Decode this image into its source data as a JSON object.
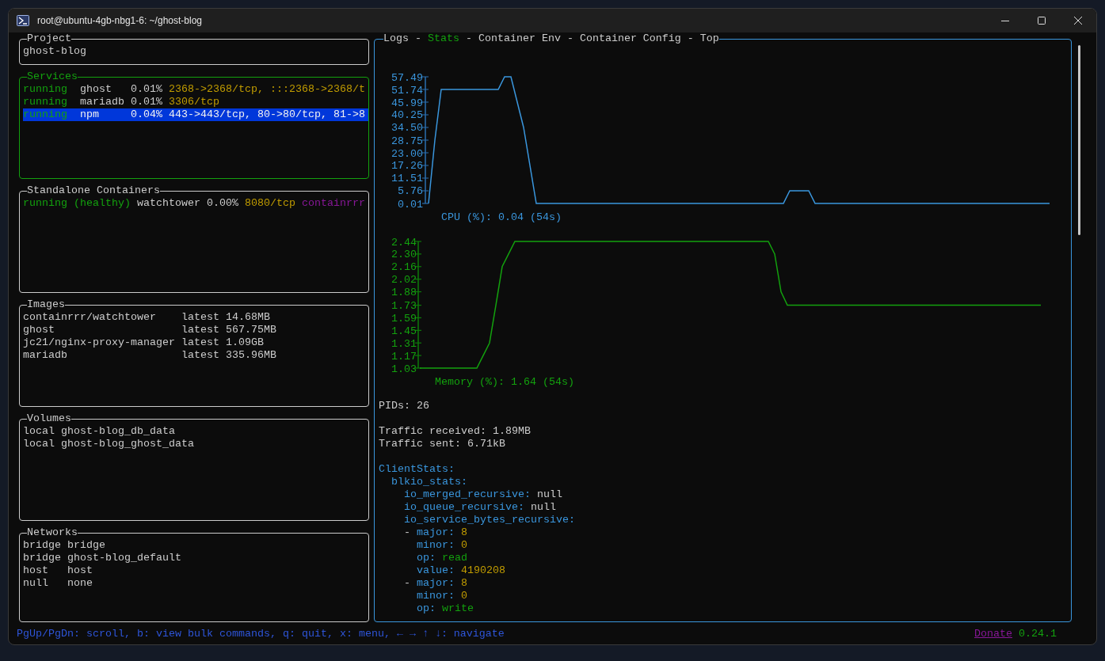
{
  "window": {
    "title": "root@ubuntu-4gb-nbg1-6: ~/ghost-blog"
  },
  "project": {
    "title": "Project",
    "name": "ghost-blog"
  },
  "services": {
    "title": "Services",
    "rows": [
      {
        "status": "running",
        "name": "ghost",
        "cpu": "0.01%",
        "ports": "2368->2368/tcp, :::2368->2368/t",
        "selected": false
      },
      {
        "status": "running",
        "name": "mariadb",
        "cpu": "0.01%",
        "ports": "3306/tcp",
        "selected": false
      },
      {
        "status": "running",
        "name": "npm",
        "cpu": "0.04%",
        "ports": "443->443/tcp, 80->80/tcp, 81->8",
        "selected": true
      }
    ]
  },
  "standalone_containers": {
    "title": "Standalone Containers",
    "rows": [
      {
        "status": "running (healthy)",
        "name": "watchtower",
        "cpu": "0.00%",
        "ports": "8080/tcp",
        "image": "containrrr"
      }
    ]
  },
  "images": {
    "title": "Images",
    "rows": [
      {
        "name": "containrrr/watchtower",
        "tag": "latest",
        "size": "14.68MB"
      },
      {
        "name": "ghost",
        "tag": "latest",
        "size": "567.75MB"
      },
      {
        "name": "jc21/nginx-proxy-manager",
        "tag": "latest",
        "size": "1.09GB"
      },
      {
        "name": "mariadb",
        "tag": "latest",
        "size": "335.96MB"
      }
    ]
  },
  "volumes": {
    "title": "Volumes",
    "rows": [
      {
        "driver": "local",
        "name": "ghost-blog_db_data"
      },
      {
        "driver": "local",
        "name": "ghost-blog_ghost_data"
      }
    ]
  },
  "networks": {
    "title": "Networks",
    "rows": [
      {
        "driver": "bridge",
        "name": "bridge"
      },
      {
        "driver": "bridge",
        "name": "ghost-blog_default"
      },
      {
        "driver": "host",
        "name": "host"
      },
      {
        "driver": "null",
        "name": "none"
      }
    ]
  },
  "detail_panel": {
    "tabs": [
      {
        "label": "Logs",
        "selected": false
      },
      {
        "label": "Stats",
        "selected": true
      },
      {
        "label": "Container Env",
        "selected": false
      },
      {
        "label": "Container Config",
        "selected": false
      },
      {
        "label": "Top",
        "selected": false
      }
    ],
    "tab_separators": [
      "-",
      "-",
      "-",
      "-"
    ],
    "cpu_chart": {
      "chart_data": {
        "type": "line",
        "title": "CPU (%): 0.04 (54s)",
        "ylim": [
          0.01,
          57.49
        ],
        "yticks": [
          {
            "value": 57.49,
            "label": "57.49"
          },
          {
            "value": 51.74,
            "label": "51.74"
          },
          {
            "value": 45.99,
            "label": "45.99"
          },
          {
            "value": 40.25,
            "label": "40.25"
          },
          {
            "value": 34.5,
            "label": "34.50"
          },
          {
            "value": 28.75,
            "label": "28.75"
          },
          {
            "value": 23,
            "label": "23.00"
          },
          {
            "value": 17.26,
            "label": "17.26"
          },
          {
            "value": 11.51,
            "label": "11.51"
          },
          {
            "value": 5.76,
            "label": "5.76"
          },
          {
            "value": 0.01,
            "label": "0.01"
          }
        ],
        "series": [
          {
            "color": "#3a96dd",
            "values": [
              0.01,
              28.75,
              51.74,
              51.74,
              51.74,
              51.74,
              51.74,
              51.74,
              51.74,
              51.74,
              51.74,
              51.74,
              57.49,
              57.49,
              45.99,
              34.5,
              17.26,
              0.01,
              0.01,
              0.01,
              0.01,
              0.01,
              0.01,
              0.01,
              0.01,
              0.01,
              0.01,
              0.01,
              0.01,
              0.01,
              0.01,
              0.01,
              0.01,
              0.01,
              0.01,
              0.01,
              0.01,
              0.01,
              0.01,
              0.01,
              0.01,
              0.01,
              0.01,
              0.01,
              0.01,
              0.01,
              0.01,
              0.01,
              0.01,
              0.01,
              0.01,
              0.01,
              0.01,
              0.01,
              0.01,
              0.01,
              0.01,
              5.76,
              5.76,
              5.76,
              5.76,
              0.01,
              0.01,
              0.01,
              0.01,
              0.01,
              0.01,
              0.01,
              0.01,
              0.01,
              0.01,
              0.01,
              0.01,
              0.01,
              0.01,
              0.01,
              0.01,
              0.01,
              0.01,
              0.01,
              0.01,
              0.01,
              0.01,
              0.01,
              0.01,
              0.01,
              0.01,
              0.01,
              0.01,
              0.01,
              0.01,
              0.01,
              0.01,
              0.01,
              0.01,
              0.01,
              0.01,
              0.01,
              0.01
            ]
          }
        ]
      }
    },
    "memory_chart": {
      "chart_data": {
        "type": "line",
        "title": "Memory (%): 1.64 (54s)",
        "ylim": [
          1.03,
          2.44
        ],
        "yticks": [
          {
            "value": 2.44,
            "label": "2.44"
          },
          {
            "value": 2.3,
            "label": "2.30"
          },
          {
            "value": 2.16,
            "label": "2.16"
          },
          {
            "value": 2.02,
            "label": "2.02"
          },
          {
            "value": 1.88,
            "label": "1.88"
          },
          {
            "value": 1.73,
            "label": "1.73"
          },
          {
            "value": 1.59,
            "label": "1.59"
          },
          {
            "value": 1.45,
            "label": "1.45"
          },
          {
            "value": 1.31,
            "label": "1.31"
          },
          {
            "value": 1.17,
            "label": "1.17"
          },
          {
            "value": 1.03,
            "label": "1.03"
          }
        ],
        "series": [
          {
            "color": "#13a10e",
            "values": [
              1.03,
              1.03,
              1.03,
              1.03,
              1.03,
              1.03,
              1.03,
              1.03,
              1.03,
              1.03,
              1.17,
              1.31,
              1.73,
              2.16,
              2.3,
              2.44,
              2.44,
              2.44,
              2.44,
              2.44,
              2.44,
              2.44,
              2.44,
              2.44,
              2.44,
              2.44,
              2.44,
              2.44,
              2.44,
              2.44,
              2.44,
              2.44,
              2.44,
              2.44,
              2.44,
              2.44,
              2.44,
              2.44,
              2.44,
              2.44,
              2.44,
              2.44,
              2.44,
              2.44,
              2.44,
              2.44,
              2.44,
              2.44,
              2.44,
              2.44,
              2.44,
              2.44,
              2.44,
              2.44,
              2.44,
              2.44,
              2.3,
              1.88,
              1.73,
              1.73,
              1.73,
              1.73,
              1.73,
              1.73,
              1.73,
              1.73,
              1.73,
              1.73,
              1.73,
              1.73,
              1.73,
              1.73,
              1.73,
              1.73,
              1.73,
              1.73,
              1.73,
              1.73,
              1.73,
              1.73,
              1.73,
              1.73,
              1.73,
              1.73,
              1.73,
              1.73,
              1.73,
              1.73,
              1.73,
              1.73,
              1.73,
              1.73,
              1.73,
              1.73,
              1.73,
              1.73,
              1.73,
              1.73,
              1.73
            ]
          }
        ]
      }
    },
    "pids": "PIDs: 26",
    "traffic": [
      "Traffic received: 1.89MB",
      "Traffic sent: 6.71kB"
    ],
    "client_stats": [
      {
        "key": "ClientStats:",
        "children": [
          {
            "key": "blkio_stats:",
            "children": [
              {
                "key": "io_merged_recursive:",
                "value": "null",
                "kind": "null"
              },
              {
                "key": "io_queue_recursive:",
                "value": "null",
                "kind": "null"
              },
              {
                "key": "io_service_bytes_recursive:",
                "children": [
                  {
                    "kind": "list_item",
                    "marker": "-",
                    "children": [
                      {
                        "key": "major:",
                        "value": "8",
                        "kind": "number"
                      },
                      {
                        "key": "minor:",
                        "value": "0",
                        "kind": "number"
                      },
                      {
                        "key": "op:",
                        "value": "read",
                        "kind": "string"
                      },
                      {
                        "key": "value:",
                        "value": "4190208",
                        "kind": "number"
                      }
                    ]
                  },
                  {
                    "kind": "list_item",
                    "marker": "-",
                    "children": [
                      {
                        "key": "major:",
                        "value": "8",
                        "kind": "number"
                      },
                      {
                        "key": "minor:",
                        "value": "0",
                        "kind": "number"
                      },
                      {
                        "key": "op:",
                        "value": "write",
                        "kind": "string"
                      }
                    ]
                  }
                ]
              }
            ]
          }
        ]
      }
    ]
  },
  "status_bar": {
    "help": "PgUp/PgDn: scroll, b: view bulk commands, q: quit, x: menu, ← → ↑ ↓: navigate",
    "donate_link": "Donate",
    "version": "0.24.1"
  }
}
